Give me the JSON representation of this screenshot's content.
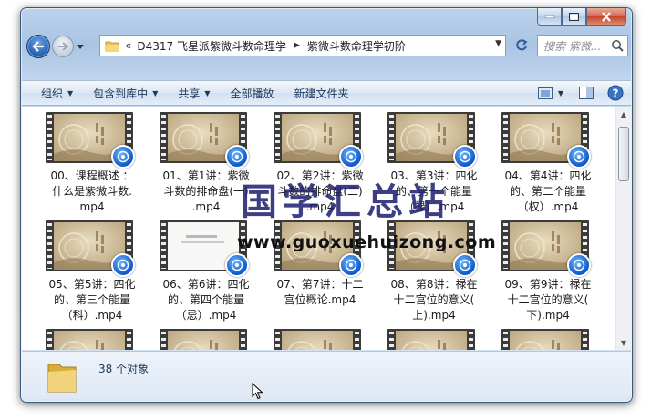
{
  "window": {
    "caption_buttons": [
      "minimize",
      "maximize",
      "close"
    ]
  },
  "address": {
    "chevron": "«",
    "segments": [
      "D4317 飞星派紫微斗数命理学",
      "紫微斗数命理学初阶"
    ]
  },
  "search": {
    "placeholder": "搜索 紫微..."
  },
  "toolbar": {
    "organize": "组织",
    "include_library": "包含到库中",
    "share": "共享",
    "play_all": "全部播放",
    "new_folder": "新建文件夹"
  },
  "files": [
    {
      "name": "00、课程概述 ：什么是紫微斗数.mp4",
      "lines": [
        "00、课程概述 ：",
        "什么是紫微斗数.",
        "mp4"
      ]
    },
    {
      "name": "01、第1讲：紫微斗数的排命盘(一).mp4",
      "lines": [
        "01、第1讲：紫微",
        "斗数的排命盘(一)",
        ".mp4"
      ]
    },
    {
      "name": "02、第2讲：紫微斗数的排命盘(二).mp4",
      "lines": [
        "02、第2讲：紫微",
        "斗数的排命盘(二)",
        ".mp4"
      ]
    },
    {
      "name": "03、第3讲：四化的、第一个能量（禄）.mp4",
      "lines": [
        "03、第3讲：四化",
        "的、第一个能量",
        "（禄）.mp4"
      ]
    },
    {
      "name": "04、第4讲：四化的、第二个能量（权）.mp4",
      "lines": [
        "04、第4讲：四化",
        "的、第二个能量",
        "（权）.mp4"
      ]
    },
    {
      "name": "05、第5讲：四化的、第三个能量（科）.mp4",
      "lines": [
        "05、第5讲：四化",
        "的、第三个能量",
        "（科）.mp4"
      ]
    },
    {
      "name": "06、第6讲：四化的、第四个能量（忌）.mp4",
      "lines": [
        "06、第6讲：四化",
        "的、第四个能量",
        "（忌）.mp4"
      ]
    },
    {
      "name": "07、第7讲：十二宫位概论.mp4",
      "lines": [
        "07、第7讲：十二",
        "宫位概论.mp4"
      ]
    },
    {
      "name": "08、第8讲：禄在十二宫位的意义(上).mp4",
      "lines": [
        "08、第8讲：禄在",
        "十二宫位的意义(",
        "上).mp4"
      ]
    },
    {
      "name": "09、第9讲：禄在十二宫位的意义(下).mp4",
      "lines": [
        "09、第9讲：禄在",
        "十二宫位的意义(",
        "下).mp4"
      ]
    }
  ],
  "watermark": {
    "title": "国学汇总站",
    "url": "www.guoxuehuizong.com"
  },
  "status": {
    "count": "38 个对象"
  },
  "colors": {
    "accent": "#1e395b",
    "vlc_blue": "#0c58c9",
    "watermark": "#1d1d70"
  }
}
